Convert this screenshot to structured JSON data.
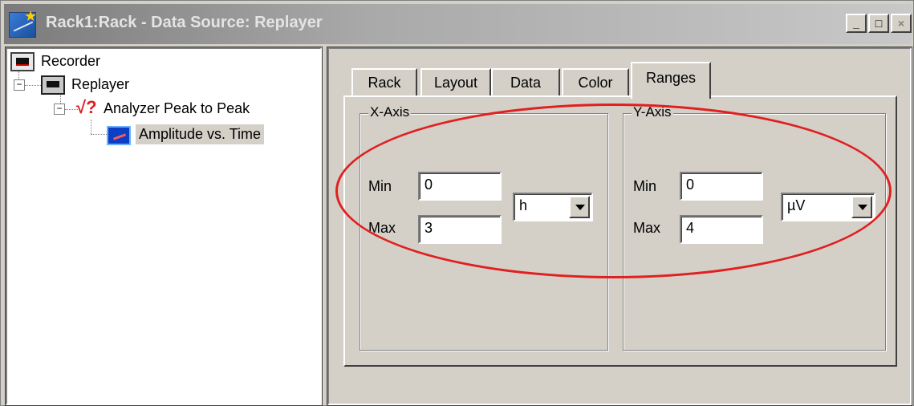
{
  "window": {
    "title": "Rack1:Rack - Data Source: Replayer",
    "controls": {
      "minimize": "_",
      "maximize": "□",
      "close": "×"
    }
  },
  "tree": {
    "nodes": [
      {
        "label": "Recorder",
        "icon": "recorder-icon"
      },
      {
        "label": "Replayer",
        "icon": "replayer-icon",
        "expander": "−"
      },
      {
        "label": "Analyzer Peak to Peak",
        "icon": "analyzer-icon",
        "expander": "−"
      },
      {
        "label": "Amplitude vs. Time",
        "icon": "chart-icon",
        "selected": true
      }
    ]
  },
  "tabs": [
    "Rack",
    "Layout",
    "Data",
    "Color",
    "Ranges"
  ],
  "active_tab": "Ranges",
  "x_axis": {
    "group_label": "X-Axis",
    "min_label": "Min",
    "min_value": "0",
    "max_label": "Max",
    "max_value": "3",
    "unit": "h"
  },
  "y_axis": {
    "group_label": "Y-Axis",
    "min_label": "Min",
    "min_value": "0",
    "max_label": "Max",
    "max_value": "4",
    "unit": "µV"
  },
  "colors": {
    "highlight_ellipse": "#e02020",
    "dialog_bg": "#d4d0c8"
  }
}
